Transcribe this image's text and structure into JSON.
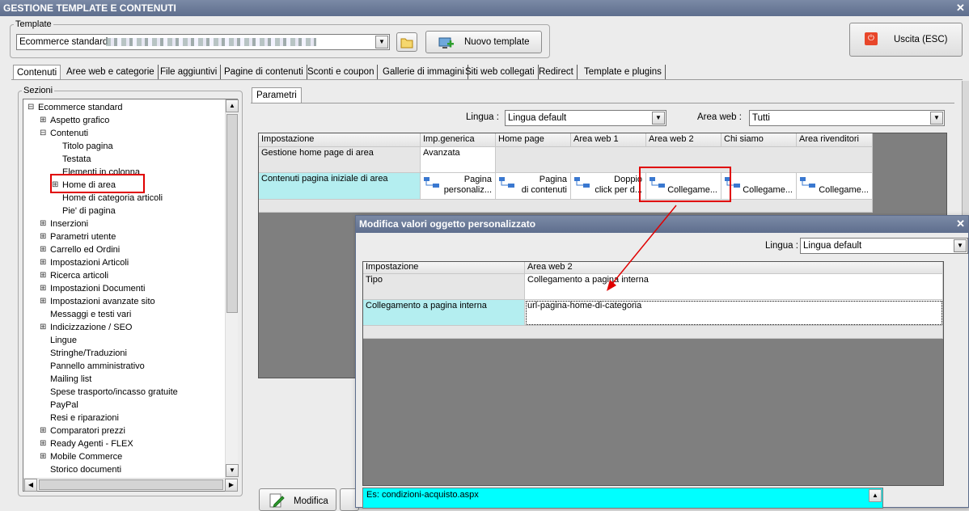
{
  "window": {
    "title": "GESTIONE TEMPLATE E CONTENUTI"
  },
  "template": {
    "group_label": "Template",
    "selected": "Ecommerce standard",
    "new_button": "Nuovo template"
  },
  "exit_button": "Uscita (ESC)",
  "tabs": [
    "Contenuti",
    "Aree web e categorie",
    "File aggiuntivi",
    "Pagine di contenuti",
    "Sconti e coupon",
    "Gallerie di immagini",
    "Siti web collegati",
    "Redirect",
    "Template e plugins"
  ],
  "sections": {
    "label": "Sezioni",
    "tree": [
      {
        "label": "Ecommerce standard",
        "exp": "−"
      },
      {
        "label": "Aspetto grafico",
        "exp": "+"
      },
      {
        "label": "Contenuti",
        "exp": "−"
      },
      {
        "label": "Titolo pagina",
        "exp": ""
      },
      {
        "label": "Testata",
        "exp": ""
      },
      {
        "label": "Elementi in colonna",
        "exp": ""
      },
      {
        "label": "Home di area",
        "exp": "+"
      },
      {
        "label": "Home di categoria articoli",
        "exp": ""
      },
      {
        "label": "Pie' di pagina",
        "exp": ""
      },
      {
        "label": "Inserzioni",
        "exp": "+"
      },
      {
        "label": "Parametri utente",
        "exp": "+"
      },
      {
        "label": "Carrello ed Ordini",
        "exp": "+"
      },
      {
        "label": "Impostazioni Articoli",
        "exp": "+"
      },
      {
        "label": "Ricerca articoli",
        "exp": "+"
      },
      {
        "label": "Impostazioni Documenti",
        "exp": "+"
      },
      {
        "label": "Impostazioni avanzate sito",
        "exp": "+"
      },
      {
        "label": "Messaggi e testi vari",
        "exp": ""
      },
      {
        "label": "Indicizzazione / SEO",
        "exp": "+"
      },
      {
        "label": "Lingue",
        "exp": ""
      },
      {
        "label": "Stringhe/Traduzioni",
        "exp": ""
      },
      {
        "label": "Pannello amministrativo",
        "exp": ""
      },
      {
        "label": "Mailing list",
        "exp": ""
      },
      {
        "label": "Spese trasporto/incasso gratuite",
        "exp": ""
      },
      {
        "label": "PayPal",
        "exp": ""
      },
      {
        "label": "Resi e riparazioni",
        "exp": ""
      },
      {
        "label": "Comparatori prezzi",
        "exp": "+"
      },
      {
        "label": "Ready Agenti - FLEX",
        "exp": "+"
      },
      {
        "label": "Mobile Commerce",
        "exp": "+"
      },
      {
        "label": "Storico documenti",
        "exp": ""
      }
    ]
  },
  "params": {
    "tab": "Parametri",
    "lingua_label": "Lingua :",
    "lingua_value": "Lingua default",
    "area_label": "Area web :",
    "area_value": "Tutti",
    "headers": [
      "Impostazione",
      "Imp.generica",
      "Home page",
      "Area web 1",
      "Area web 2",
      "Chi siamo",
      "Area rivenditori"
    ],
    "row1": {
      "label": "Gestione home page di area",
      "generic": "Avanzata"
    },
    "row2": {
      "label": "Contenuti pagina iniziale di area",
      "generic_line1": "Pagina",
      "generic_line2": "personaliz...",
      "home_line1": "Pagina",
      "home_line2": "di contenuti",
      "aw1_line1": "Doppio",
      "aw1_line2": "click per d...",
      "aw2": "Collegame...",
      "chi": "Collegame...",
      "riv": "Collegame..."
    }
  },
  "dialog": {
    "title": "Modifica valori oggetto personalizzato",
    "lingua_label": "Lingua :",
    "lingua_value": "Lingua default",
    "headers": [
      "Impostazione",
      "Area web 2"
    ],
    "rows": [
      {
        "label": "Tipo",
        "value": "Collegamento a pagina interna"
      },
      {
        "label": "Collegamento a pagina interna",
        "value": "url-pagina-home-di-categoria"
      }
    ],
    "hint": "Es: condizioni-acquisto.aspx"
  },
  "bottom": {
    "modify_button": "Modifica"
  },
  "colors": {
    "title_bar": "#6a7a98",
    "highlight_cell": "#b4eef0",
    "annotation": "#e00000",
    "hint_bg": "#00ffff"
  }
}
